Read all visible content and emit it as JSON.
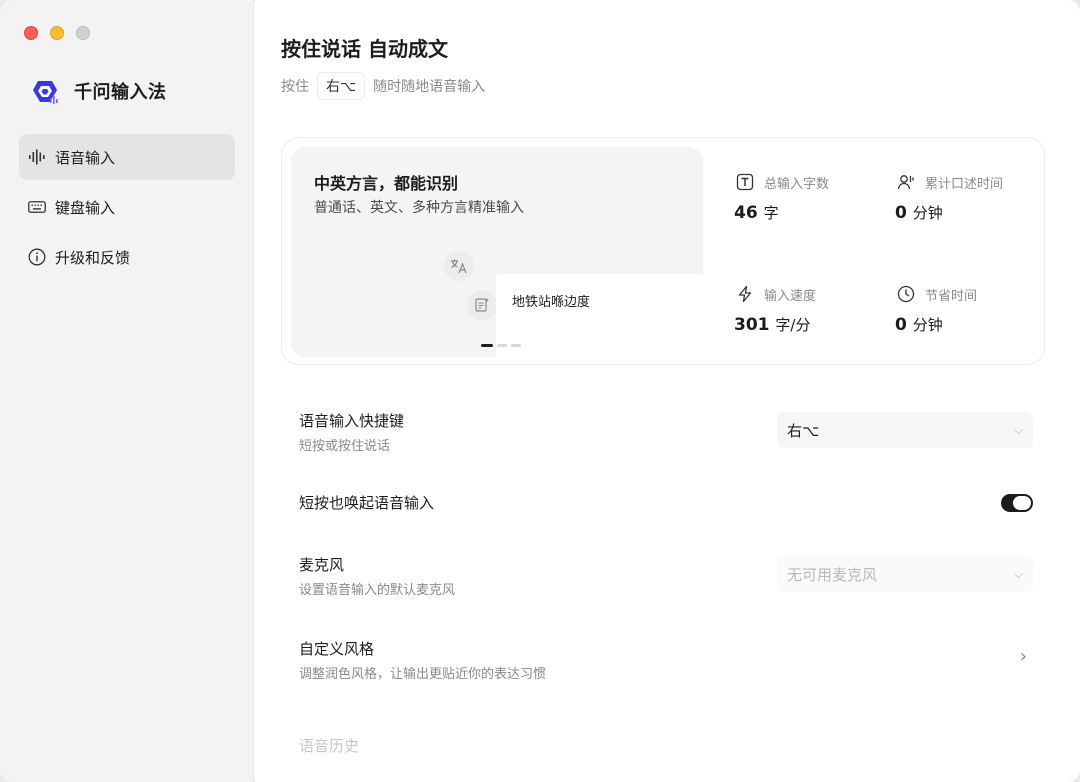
{
  "app": {
    "name": "千问输入法",
    "accent_color": "#3a36e8"
  },
  "sidebar": {
    "items": [
      {
        "label": "语音输入",
        "icon": "waveform-icon",
        "active": true
      },
      {
        "label": "键盘输入",
        "icon": "keyboard-icon",
        "active": false
      },
      {
        "label": "升级和反馈",
        "icon": "info-icon",
        "active": false
      }
    ]
  },
  "header": {
    "title": "按住说话 自动成文",
    "subtitle_prefix": "按住",
    "hotkey": "右⌥",
    "subtitle_suffix": "随时随地语音输入"
  },
  "feature": {
    "title": "中英方言，都能识别",
    "subtitle": "普通话、英文、多种方言精准输入",
    "demo_text": "地铁站喺边度",
    "carousel_pages": 3,
    "carousel_active": 1
  },
  "stats": [
    {
      "label": "总输入字数",
      "value": "46",
      "unit": "字",
      "icon": "text-box-icon"
    },
    {
      "label": "累计口述时间",
      "value": "0",
      "unit": "分钟",
      "icon": "speaking-person-icon"
    },
    {
      "label": "输入速度",
      "value": "301",
      "unit": "字/分",
      "icon": "lightning-icon"
    },
    {
      "label": "节省时间",
      "value": "0",
      "unit": "分钟",
      "icon": "clock-icon"
    }
  ],
  "settings": {
    "hotkey": {
      "label": "语音输入快捷键",
      "desc": "短按或按住说话",
      "value": "右⌥"
    },
    "short_press": {
      "label": "短按也唤起语音输入",
      "enabled": true
    },
    "microphone": {
      "label": "麦克风",
      "desc": "设置语音输入的默认麦克风",
      "value": "无可用麦克风"
    },
    "style": {
      "label": "自定义风格",
      "desc": "调整润色风格，让输出更贴近你的表达习惯"
    },
    "history_heading": "语音历史"
  }
}
